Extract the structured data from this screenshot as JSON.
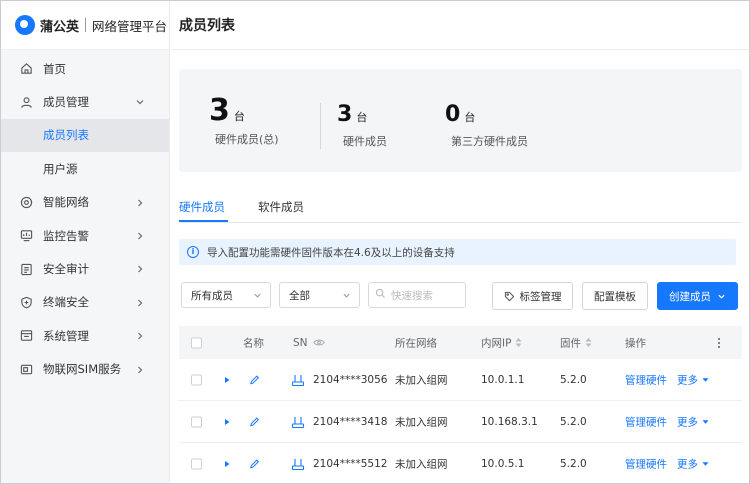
{
  "brand": {
    "name": "蒲公英",
    "subtitle": "网络管理平台"
  },
  "sidebar": {
    "items": [
      {
        "label": "首页",
        "icon": "home-icon"
      },
      {
        "label": "成员管理",
        "icon": "user-icon",
        "expanded": true
      },
      {
        "label": "成员列表",
        "active": true
      },
      {
        "label": "用户源"
      },
      {
        "label": "智能网络",
        "icon": "network-icon"
      },
      {
        "label": "监控告警",
        "icon": "monitor-icon"
      },
      {
        "label": "安全审计",
        "icon": "audit-icon"
      },
      {
        "label": "终端安全",
        "icon": "shield-icon"
      },
      {
        "label": "系统管理",
        "icon": "system-icon"
      },
      {
        "label": "物联网SIM服务",
        "icon": "sim-icon"
      }
    ]
  },
  "header": {
    "title": "成员列表"
  },
  "stats": [
    {
      "value": "3",
      "unit": "台",
      "label": "硬件成员(总)"
    },
    {
      "value": "3",
      "unit": "台",
      "label": "硬件成员"
    },
    {
      "value": "0",
      "unit": "台",
      "label": "第三方硬件成员"
    }
  ],
  "tabs": [
    {
      "label": "硬件成员",
      "active": true
    },
    {
      "label": "软件成员"
    }
  ],
  "notice": "导入配置功能需硬件固件版本在4.6及以上的设备支持",
  "filters": {
    "member_select": "所有成员",
    "status_select": "全部",
    "search_placeholder": "快速搜索"
  },
  "buttons": {
    "tag_manage": "标签管理",
    "config_template": "配置模板",
    "create_member": "创建成员"
  },
  "table": {
    "columns": {
      "name": "名称",
      "sn": "SN",
      "network": "所在网络",
      "ip": "内网IP",
      "firmware": "固件",
      "action": "操作"
    },
    "rows": [
      {
        "sn": "2104****3056",
        "network": "未加入组网",
        "ip": "10.0.1.1",
        "firmware": "5.2.0",
        "manage": "管理硬件",
        "more": "更多"
      },
      {
        "sn": "2104****3418",
        "network": "未加入组网",
        "ip": "10.168.3.1",
        "firmware": "5.2.0",
        "manage": "管理硬件",
        "more": "更多"
      },
      {
        "sn": "2104****5512",
        "network": "未加入组网",
        "ip": "10.0.5.1",
        "firmware": "5.2.0",
        "manage": "管理硬件",
        "more": "更多"
      }
    ]
  },
  "colors": {
    "accent": "#1677ff",
    "sidebar_bg": "#f5f6f7",
    "notice_bg": "#e8f3ff"
  }
}
